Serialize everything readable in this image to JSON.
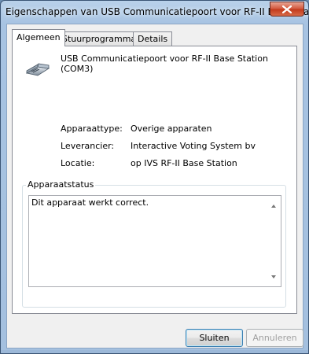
{
  "window": {
    "title": "Eigenschappen van USB Communicatiepoort voor RF-II Base Sta..."
  },
  "tabs": [
    {
      "label": "Algemeen",
      "active": true
    },
    {
      "label": "Stuurprogramma",
      "active": false
    },
    {
      "label": "Details",
      "active": false
    }
  ],
  "device": {
    "name": "USB Communicatiepoort voor RF-II Base Station (COM3)",
    "icon": "serial-port-icon"
  },
  "properties": [
    {
      "label": "Apparaattype:",
      "value": "Overige apparaten"
    },
    {
      "label": "Leverancier:",
      "value": "Interactive Voting System bv"
    },
    {
      "label": "Locatie:",
      "value": "op IVS RF-II Base Station"
    }
  ],
  "status": {
    "group_label": "Apparaatstatus",
    "text": "Dit apparaat werkt correct."
  },
  "buttons": {
    "close_label": "Sluiten",
    "cancel_label": "Annuleren"
  },
  "colors": {
    "accent": "#3c7fb1",
    "close_button": "#c2391a"
  }
}
